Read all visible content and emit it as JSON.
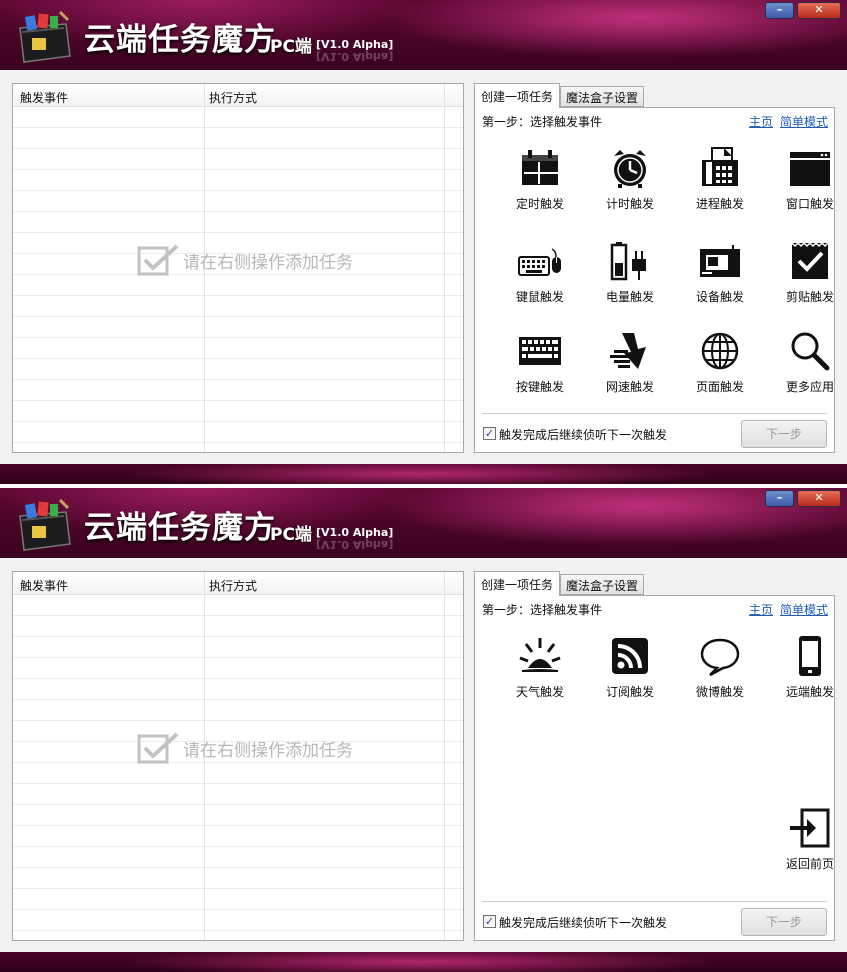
{
  "app": {
    "title": "云端任务魔方",
    "pc_label": "PC端",
    "version": "[V1.0 Alpha]",
    "minimize": "–",
    "close": "✕"
  },
  "list": {
    "col_trigger": "触发事件",
    "col_method": "执行方式",
    "empty_hint": "请在右侧操作添加任务"
  },
  "tabs": {
    "create": "创建一项任务",
    "settings": "魔法盒子设置"
  },
  "panel": {
    "step": "第一步：选择触发事件",
    "home_link": "主页",
    "simple_link": "简单模式",
    "continue_label": "触发完成后继续侦听下一次触发",
    "continue_checked": true,
    "check_mark": "✓",
    "next_button": "下一步"
  },
  "page1_items": [
    {
      "label": "定时触发",
      "icon": "calendar-icon"
    },
    {
      "label": "计时触发",
      "icon": "alarm-clock-icon"
    },
    {
      "label": "进程触发",
      "icon": "fax-machine-icon"
    },
    {
      "label": "窗口触发",
      "icon": "window-icon"
    },
    {
      "label": "键鼠触发",
      "icon": "keyboard-mouse-icon"
    },
    {
      "label": "电量触发",
      "icon": "battery-plug-icon"
    },
    {
      "label": "设备触发",
      "icon": "device-icon"
    },
    {
      "label": "剪贴触发",
      "icon": "clipboard-check-icon"
    },
    {
      "label": "按键触发",
      "icon": "keyboard-icon"
    },
    {
      "label": "网速触发",
      "icon": "network-speed-icon"
    },
    {
      "label": "页面触发",
      "icon": "globe-icon"
    },
    {
      "label": "更多应用",
      "icon": "magnifier-icon"
    }
  ],
  "page2_items": [
    {
      "label": "天气触发",
      "icon": "sunrise-icon"
    },
    {
      "label": "订阅触发",
      "icon": "rss-icon"
    },
    {
      "label": "微博触发",
      "icon": "speech-bubble-icon"
    },
    {
      "label": "远端触发",
      "icon": "phone-icon"
    }
  ],
  "page2_back": {
    "label": "返回前页",
    "icon": "return-icon"
  }
}
